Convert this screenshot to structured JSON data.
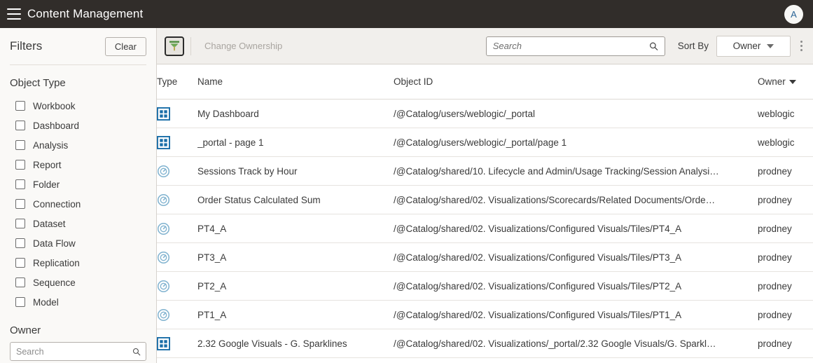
{
  "header": {
    "title": "Content Management",
    "menu_icon": "hamburger-icon",
    "avatar_initial": "A"
  },
  "filters": {
    "title": "Filters",
    "clear_label": "Clear",
    "object_type": {
      "title": "Object Type",
      "items": [
        {
          "label": "Workbook",
          "checked": false
        },
        {
          "label": "Dashboard",
          "checked": false
        },
        {
          "label": "Analysis",
          "checked": false
        },
        {
          "label": "Report",
          "checked": false
        },
        {
          "label": "Folder",
          "checked": false
        },
        {
          "label": "Connection",
          "checked": false
        },
        {
          "label": "Dataset",
          "checked": false
        },
        {
          "label": "Data Flow",
          "checked": false
        },
        {
          "label": "Replication",
          "checked": false
        },
        {
          "label": "Sequence",
          "checked": false
        },
        {
          "label": "Model",
          "checked": false
        }
      ]
    },
    "owner": {
      "title": "Owner",
      "search_placeholder": "Search",
      "search_value": "",
      "search_icon": "search-icon"
    }
  },
  "toolbar": {
    "filter_toggle_icon": "funnel-icon",
    "filter_toggle_active": true,
    "change_ownership_label": "Change Ownership",
    "change_ownership_disabled": true,
    "search_placeholder": "Search",
    "search_value": "",
    "search_icon": "search-icon",
    "sort_by_label": "Sort By",
    "sort_by_value": "Owner",
    "overflow_icon": "kebab-menu-icon"
  },
  "table": {
    "columns": [
      {
        "key": "type",
        "label": "Type"
      },
      {
        "key": "name",
        "label": "Name"
      },
      {
        "key": "objid",
        "label": "Object ID"
      },
      {
        "key": "owner",
        "label": "Owner",
        "sorted": true,
        "sort_icon": "caret-down-icon"
      }
    ],
    "rows": [
      {
        "icon": "dashboard-icon",
        "name": "My Dashboard",
        "objid": "/@Catalog/users/weblogic/_portal",
        "owner": "weblogic"
      },
      {
        "icon": "dashboard-icon",
        "name": "_portal - page 1",
        "objid": "/@Catalog/users/weblogic/_portal/page 1",
        "owner": "weblogic"
      },
      {
        "icon": "analysis-gauge-icon",
        "name": "Sessions Track by Hour",
        "objid": "/@Catalog/shared/10. Lifecycle and Admin/Usage Tracking/Session Analysi…",
        "owner": "prodney"
      },
      {
        "icon": "analysis-gauge-icon",
        "name": "Order Status Calculated Sum",
        "objid": "/@Catalog/shared/02. Visualizations/Scorecards/Related Documents/Orde…",
        "owner": "prodney"
      },
      {
        "icon": "analysis-gauge-icon",
        "name": "PT4_A",
        "objid": "/@Catalog/shared/02. Visualizations/Configured Visuals/Tiles/PT4_A",
        "owner": "prodney"
      },
      {
        "icon": "analysis-gauge-icon",
        "name": "PT3_A",
        "objid": "/@Catalog/shared/02. Visualizations/Configured Visuals/Tiles/PT3_A",
        "owner": "prodney"
      },
      {
        "icon": "analysis-gauge-icon",
        "name": "PT2_A",
        "objid": "/@Catalog/shared/02. Visualizations/Configured Visuals/Tiles/PT2_A",
        "owner": "prodney"
      },
      {
        "icon": "analysis-gauge-icon",
        "name": "PT1_A",
        "objid": "/@Catalog/shared/02. Visualizations/Configured Visuals/Tiles/PT1_A",
        "owner": "prodney"
      },
      {
        "icon": "dashboard-icon",
        "name": "2.32 Google Visuals - G. Sparklines",
        "objid": "/@Catalog/shared/02. Visualizations/_portal/2.32 Google Visuals/G. Sparkl…",
        "owner": "prodney"
      }
    ]
  },
  "colors": {
    "topbar_bg": "#312d2a",
    "panel_bg": "#faf9f7",
    "toolbar_bg": "#f1efec",
    "dashboard_icon": "#1a6ea8",
    "gauge_icon": "#7fb2cf",
    "funnel_green": "#4b8b3b",
    "funnel_stem": "#b5a642",
    "avatar_text": "#2a6496"
  }
}
